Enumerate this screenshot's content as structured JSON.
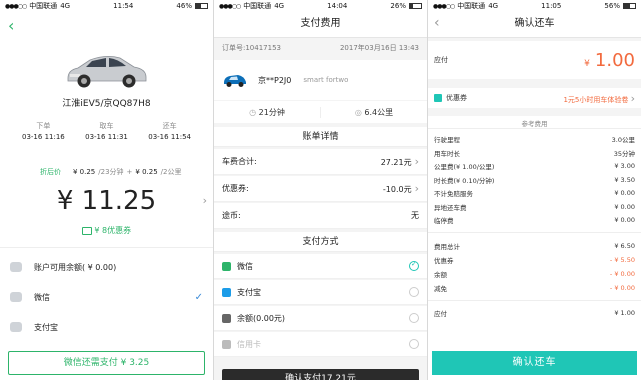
{
  "panel1": {
    "status": {
      "dots": "●●●○○",
      "carrier": "中国联通",
      "net": "4G",
      "time": "11:54",
      "battery": "46%",
      "battery_fill": 0.46
    },
    "back_icon": "chevron-left-icon",
    "car_name": "江淮iEV5/京QQ87H8",
    "times": [
      {
        "label": "下单",
        "value": "03-16 11:16"
      },
      {
        "label": "取车",
        "value": "03-16 11:31"
      },
      {
        "label": "还车",
        "value": "03-16 11:54"
      }
    ],
    "discount_label": "折后价",
    "price_detail_1": "¥ 0.25",
    "price_detail_1_unit": "/23分钟",
    "price_plus": "+",
    "price_detail_2": "¥ 0.25",
    "price_detail_2_unit": "/2公里",
    "amount": "¥ 11.25",
    "coupon_tag": "¥ 8优惠券",
    "payment_options": [
      {
        "icon": "wallet-icon",
        "label": "账户可用余额( ¥ 0.00)"
      },
      {
        "icon": "wechat-icon",
        "label": "微信",
        "selected": true
      },
      {
        "icon": "alipay-icon",
        "label": "支付宝"
      }
    ],
    "pay_button": "微信还需支付 ¥ 3.25",
    "accent": "#2db46a"
  },
  "panel2": {
    "status": {
      "dots": "●●●○○",
      "carrier": "中国联通",
      "net": "4G",
      "time": "14:04",
      "battery": "26%",
      "battery_fill": 0.26
    },
    "title": "支付费用",
    "order_no": "订单号:10417153",
    "order_date": "2017年03月16日 13:43",
    "plate": "京**P2J0",
    "car_model": "smart fortwo",
    "duration": "21分钟",
    "distance": "6.4公里",
    "bill_header": "账单详情",
    "bill_rows": [
      {
        "label": "车费合计:",
        "value": "27.21元",
        "chev": true
      },
      {
        "label": "优惠券:",
        "value": "-10.0元",
        "chev": true
      },
      {
        "label": "途币:",
        "value": "无",
        "chev": false
      }
    ],
    "pay_header": "支付方式",
    "pay_methods": [
      {
        "icon": "wechat-icon",
        "label": "微信",
        "checked": true,
        "disabled": false
      },
      {
        "icon": "alipay-icon",
        "label": "支付宝",
        "checked": false,
        "disabled": false
      },
      {
        "icon": "balance-icon",
        "label": "余额(0.00元)",
        "checked": false,
        "disabled": false
      },
      {
        "icon": "card-icon",
        "label": "信用卡",
        "checked": false,
        "disabled": true
      }
    ],
    "confirm_button": "确认支付17.21元"
  },
  "panel3": {
    "status": {
      "dots": "●●●○○",
      "carrier": "中国联通",
      "net": "4G",
      "time": "11:05",
      "battery": "56%",
      "battery_fill": 0.56
    },
    "title": "确认还车",
    "due_label": "应付",
    "due_symbol": "¥",
    "due_amount": "1.00",
    "coupon_label": "优惠券",
    "coupon_value": "1元5小时用车体验卷",
    "fee_header": "参考费用",
    "fee_rows": [
      {
        "label": "行驶里程",
        "value": "3.0公里",
        "red": false
      },
      {
        "label": "用车时长",
        "value": "35分钟",
        "red": false
      },
      {
        "label": "公里费(¥ 1.00/公里)",
        "value": "¥ 3.00",
        "red": false
      },
      {
        "label": "时长费(¥ 0.10/分钟)",
        "value": "¥ 3.50",
        "red": false
      },
      {
        "label": "不计免赔服务",
        "value": "¥ 0.00",
        "red": false
      },
      {
        "label": "异地还车费",
        "value": "¥ 0.00",
        "red": false
      },
      {
        "label": "临停费",
        "value": "¥ 0.00",
        "red": false
      }
    ],
    "total_rows": [
      {
        "label": "费用总计",
        "value": "¥ 6.50",
        "red": false
      },
      {
        "label": "优惠券",
        "value": "- ¥ 5.50",
        "red": true
      },
      {
        "label": "余额",
        "value": "- ¥ 0.00",
        "red": true
      },
      {
        "label": "减免",
        "value": "- ¥ 0.00",
        "red": true
      }
    ],
    "pay_row": {
      "label": "应付",
      "value": "¥ 1.00"
    },
    "confirm_button": "确认还车",
    "accent": "#1fc6b6"
  }
}
